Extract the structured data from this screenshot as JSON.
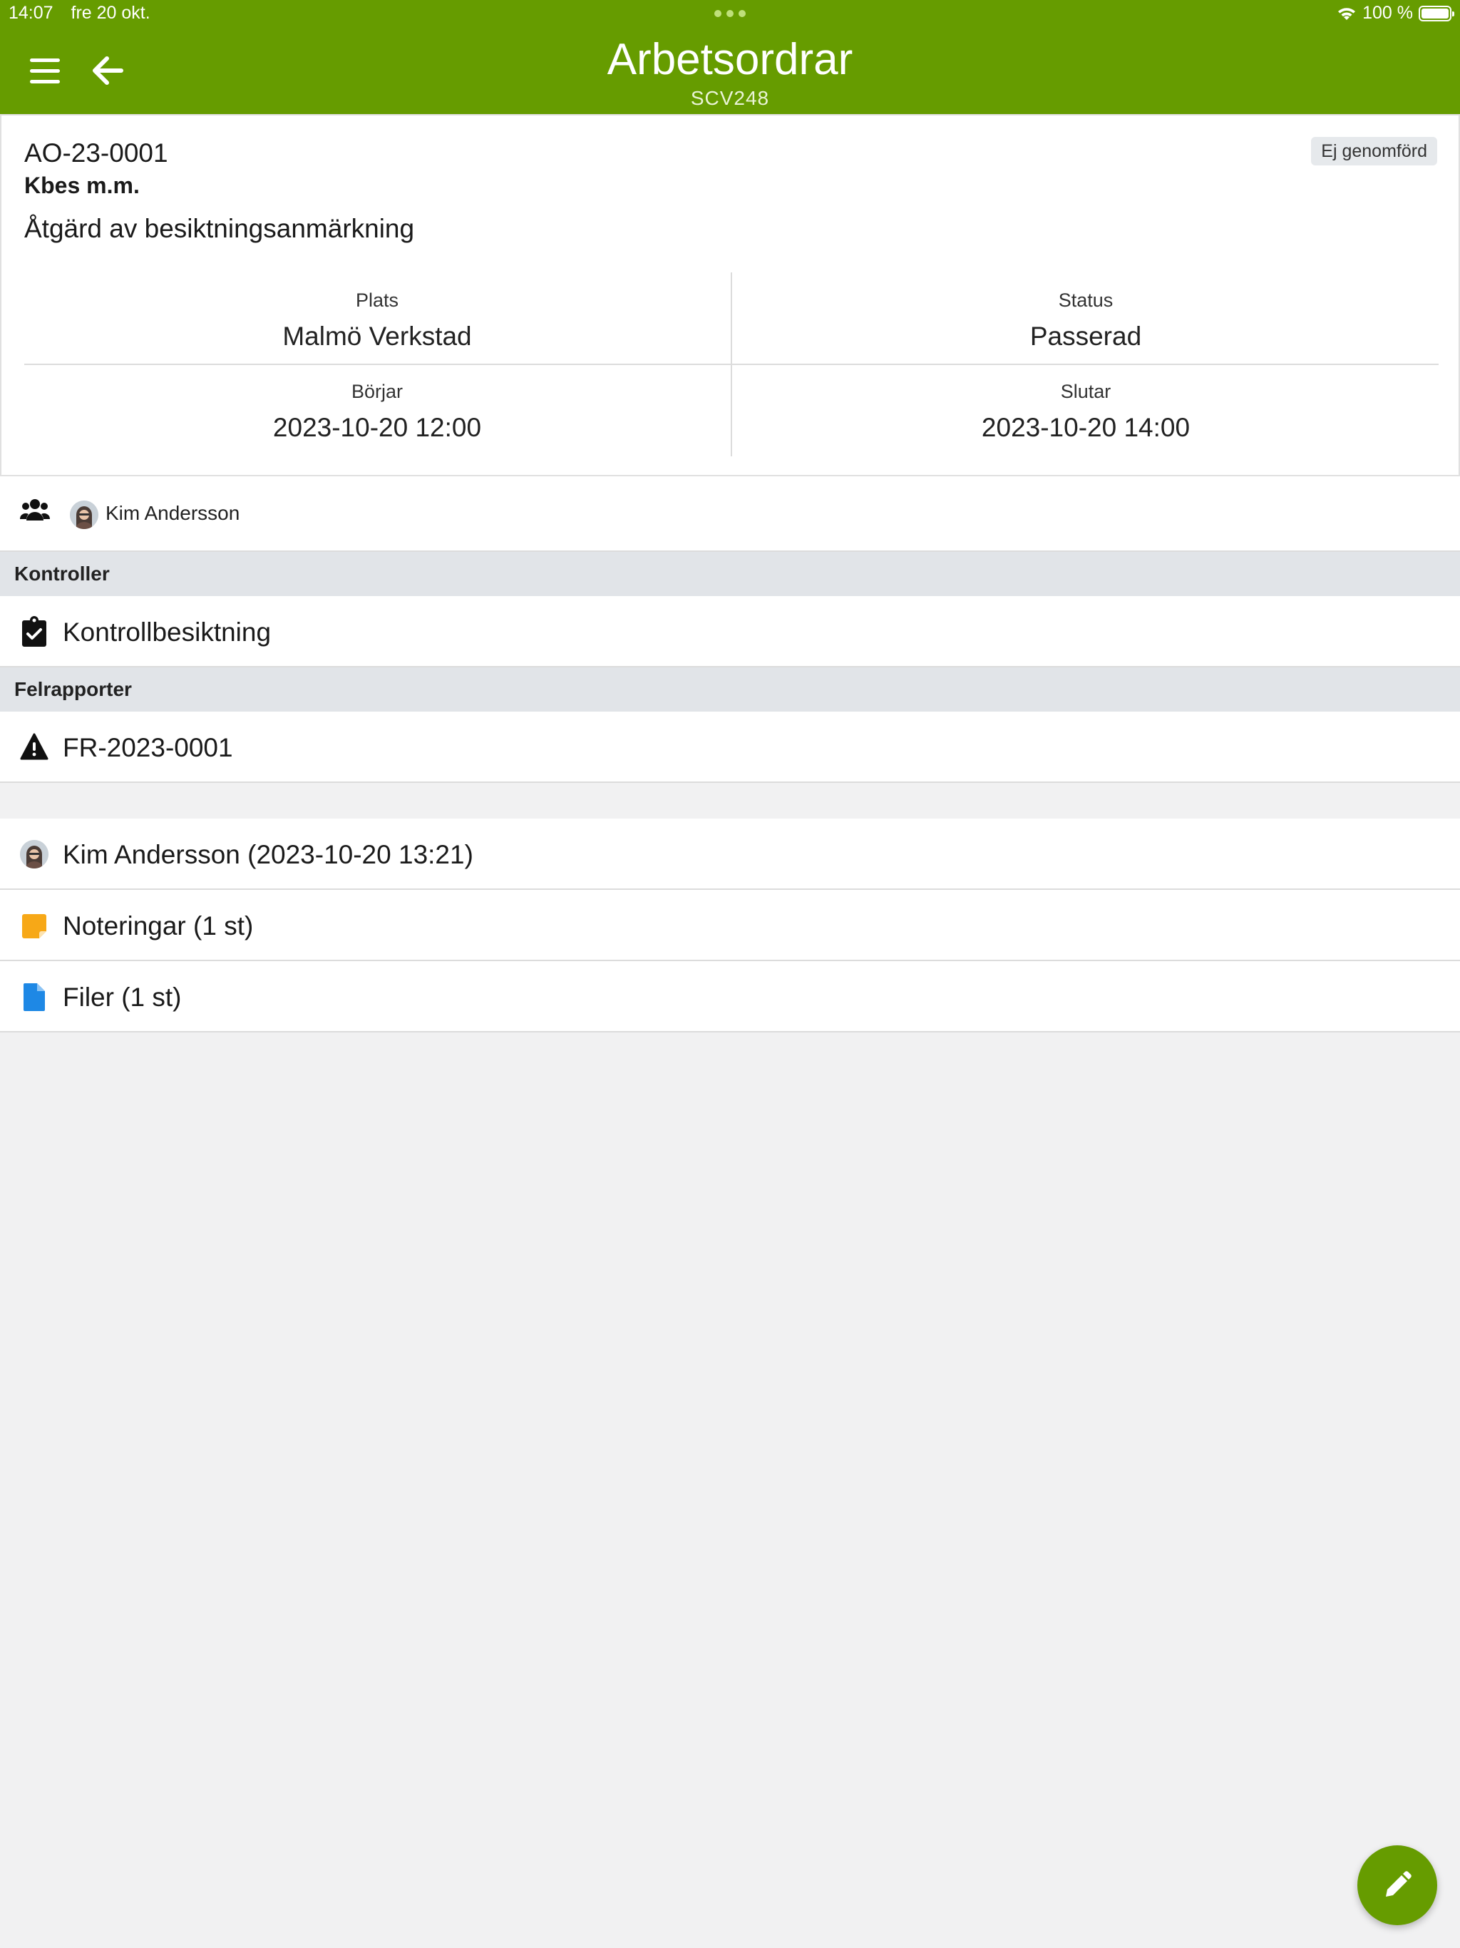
{
  "status_bar": {
    "time": "14:07",
    "date": "fre 20 okt.",
    "battery": "100 %"
  },
  "header": {
    "title": "Arbetsordrar",
    "subtitle": "SCV248"
  },
  "order": {
    "id": "AO-23-0001",
    "name": "Kbes m.m.",
    "description": "Åtgärd av besiktningsanmärkning",
    "badge": "Ej genomförd",
    "fields": {
      "place_label": "Plats",
      "place_value": "Malmö Verkstad",
      "status_label": "Status",
      "status_value": "Passerad",
      "start_label": "Börjar",
      "start_value": "2023-10-20 12:00",
      "end_label": "Slutar",
      "end_value": "2023-10-20 14:00"
    }
  },
  "assignee": {
    "name": "Kim Andersson"
  },
  "sections": {
    "controls_header": "Kontroller",
    "controls_item": "Kontrollbesiktning",
    "faults_header": "Felrapporter",
    "faults_item": "FR-2023-0001"
  },
  "meta": {
    "author": "Kim Andersson (2023-10-20 13:21)",
    "notes": "Noteringar (1 st)",
    "files": "Filer (1 st)"
  },
  "colors": {
    "brand": "#669c00",
    "note_icon": "#f7a817",
    "file_icon": "#1e88e5"
  },
  "icons": [
    "menu-icon",
    "back-arrow-icon",
    "people-icon",
    "clipboard-check-icon",
    "warning-icon",
    "note-icon",
    "file-icon",
    "pencil-icon",
    "wifi-icon",
    "battery-icon"
  ]
}
